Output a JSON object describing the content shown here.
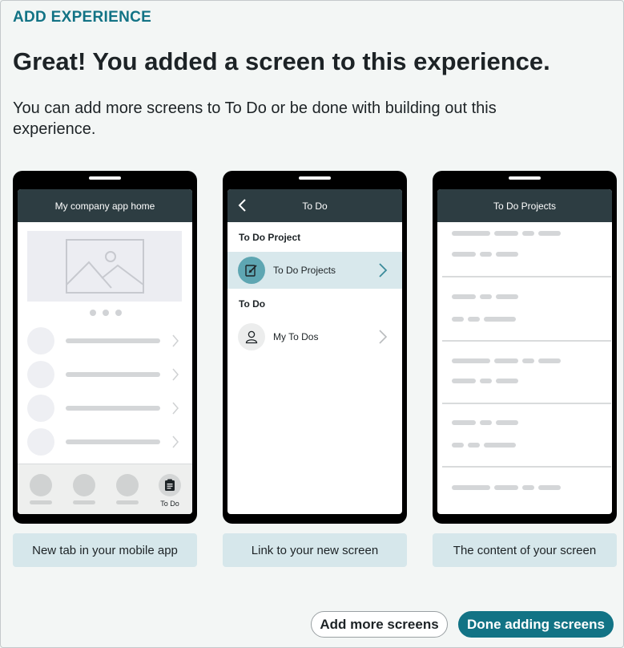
{
  "kicker": "ADD EXPERIENCE",
  "headline": "Great! You added a screen to this experience.",
  "subtext": "You can add more screens to To Do or be done with building out this experience.",
  "phones": {
    "home": {
      "title": "My company app home",
      "tab_label": "To Do",
      "icons": {
        "hero": "image-placeholder-icon",
        "tab": "clipboard-icon"
      }
    },
    "todo": {
      "title": "To Do",
      "section1": "To Do Project",
      "item1": "To Do Projects",
      "section2": "To Do",
      "item2": "My To Dos",
      "icons": {
        "back": "chevron-left-icon",
        "item1": "edit-document-icon",
        "item2": "person-icon"
      }
    },
    "projects": {
      "title": "To Do Projects"
    }
  },
  "captions": {
    "tab": "New tab in your mobile app",
    "link": "Link to your new screen",
    "content": "The content of your screen"
  },
  "actions": {
    "add_more": "Add more screens",
    "done": "Done adding screens"
  },
  "colors": {
    "accent": "#127385",
    "appbar": "#2d3d42",
    "caption_bg": "#d6e7eb",
    "active_row": "#d8e8ec"
  }
}
